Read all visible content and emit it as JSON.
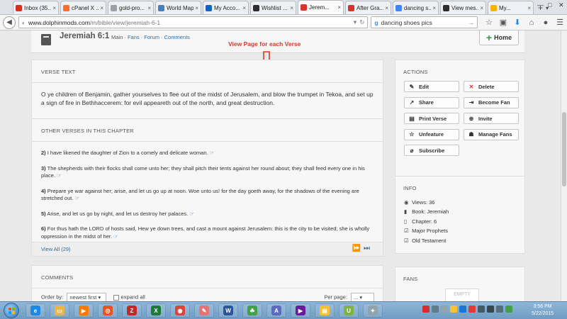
{
  "browser": {
    "tabs": [
      {
        "label": "Inbox (35...",
        "color": "#d93025",
        "active": false
      },
      {
        "label": "cPanel X ...",
        "color": "#ff6c2c",
        "active": false
      },
      {
        "label": "gold-pro...",
        "color": "#9aa0a6",
        "active": false
      },
      {
        "label": "World Map A...",
        "color": "#4a7ebb",
        "active": false
      },
      {
        "label": "My Acco...",
        "color": "#1565c0",
        "active": false
      },
      {
        "label": "Wishlist ...",
        "color": "#2e2e2e",
        "active": false
      },
      {
        "label": "Jerem...",
        "color": "#d9342b",
        "active": true
      },
      {
        "label": "After Gra...",
        "color": "#d9342b",
        "active": false
      },
      {
        "label": "dancing s...",
        "color": "#4285f4",
        "active": false
      },
      {
        "label": "View mes...",
        "color": "#2e2e2e",
        "active": false
      },
      {
        "label": "My...",
        "color": "#f4b400",
        "active": false
      }
    ],
    "url_prefix": "www.dolphinmods.com",
    "url_path": "/m/bible/view/jeremiah-6-1",
    "search_value": "dancing shoes pics"
  },
  "header": {
    "title": "Jeremiah 6:1",
    "links": [
      "Main",
      "Fans",
      "Forum",
      "Comments"
    ],
    "home_label": "Home"
  },
  "annotation": "View Page for each Verse",
  "verse": {
    "heading": "VERSE TEXT",
    "text": "O ye children of Benjamin, gather yourselves to flee out of the midst of Jerusalem, and blow the trumpet in Tekoa, and set up a sign of fire in Bethhaccerem: for evil appeareth out of the north, and great destruction."
  },
  "other_verses": {
    "heading": "OTHER VERSES IN THIS CHAPTER",
    "items": [
      {
        "num": "2)",
        "text": "I have likened the daughter of Zion to a comely and delicate woman."
      },
      {
        "num": "3)",
        "text": "The shepherds with their flocks shall come unto her; they shall pitch their tents against her round about; they shall feed every one in his place."
      },
      {
        "num": "4)",
        "text": "Prepare ye war against her; arise, and let us go up at noon. Woe unto us! for the day goeth away, for the shadows of the evening are stretched out."
      },
      {
        "num": "5)",
        "text": "Arise, and let us go by night, and let us destroy her palaces."
      },
      {
        "num": "6)",
        "text": "For thus hath the LORD of hosts said, Hew ye down trees, and cast a mount against Jerusalem: this is the city to be visited; she is wholly oppression in the midst of her."
      }
    ],
    "view_all": "View All (29)"
  },
  "comments": {
    "heading": "COMMENTS",
    "order_label": "Order by:",
    "order_value": "newest first",
    "expand_label": "expand all",
    "per_page_label": "Per page:",
    "per_page_value": "..."
  },
  "actions": {
    "heading": "ACTIONS",
    "buttons": [
      {
        "label": "Edit",
        "icon": "edit-icon",
        "glyph": "✎",
        "color": "#333333"
      },
      {
        "label": "Delete",
        "icon": "delete-icon",
        "glyph": "✕",
        "color": "#d9342b"
      },
      {
        "label": "Share",
        "icon": "share-icon",
        "glyph": "↗",
        "color": "#333333"
      },
      {
        "label": "Become Fan",
        "icon": "become-fan-icon",
        "glyph": "⇥",
        "color": "#333333"
      },
      {
        "label": "Print Verse",
        "icon": "print-icon",
        "glyph": "▤",
        "color": "#333333"
      },
      {
        "label": "Invite",
        "icon": "invite-icon",
        "glyph": "⊕",
        "color": "#333333"
      },
      {
        "label": "Unfeature",
        "icon": "star-icon",
        "glyph": "☆",
        "color": "#333333"
      },
      {
        "label": "Manage Fans",
        "icon": "users-icon",
        "glyph": "☗",
        "color": "#333333"
      },
      {
        "label": "Subscribe",
        "icon": "paperclip-icon",
        "glyph": "⌀",
        "color": "#333333"
      }
    ]
  },
  "info": {
    "heading": "INFO",
    "items": [
      {
        "icon": "eye-icon",
        "glyph": "◉",
        "text": "Views: 36"
      },
      {
        "icon": "book-icon",
        "glyph": "▮",
        "text": "Book: Jeremiah"
      },
      {
        "icon": "bookmark-icon",
        "glyph": "▯",
        "text": "Chapter: 6"
      },
      {
        "icon": "check-icon",
        "glyph": "☑",
        "text": "Major Prophets"
      },
      {
        "icon": "check-icon",
        "glyph": "☑",
        "text": "Old Testament"
      }
    ]
  },
  "fans": {
    "heading": "FANS",
    "empty_label": "EMPTY"
  },
  "taskbar": {
    "apps": [
      {
        "name": "internet-explorer",
        "glyph": "e",
        "color": "#1e88e5"
      },
      {
        "name": "file-explorer",
        "glyph": "▭",
        "color": "#e6b84a"
      },
      {
        "name": "media-player",
        "glyph": "▶",
        "color": "#f57c00"
      },
      {
        "name": "firefox",
        "glyph": "◎",
        "color": "#e8541e"
      },
      {
        "name": "filezilla",
        "glyph": "Z",
        "color": "#c62828"
      },
      {
        "name": "excel",
        "glyph": "X",
        "color": "#1d7a3a"
      },
      {
        "name": "chrome",
        "glyph": "◉",
        "color": "#db4437"
      },
      {
        "name": "paint",
        "glyph": "✎",
        "color": "#e57373"
      },
      {
        "name": "word",
        "glyph": "W",
        "color": "#2b579a"
      },
      {
        "name": "frog-app",
        "glyph": "☘",
        "color": "#43a047"
      },
      {
        "name": "ab-app",
        "glyph": "A",
        "color": "#5c6bc0"
      },
      {
        "name": "purple-app",
        "glyph": "▶",
        "color": "#6a1b9a"
      },
      {
        "name": "notes-app",
        "glyph": "▤",
        "color": "#fbc02d"
      },
      {
        "name": "ultraedit",
        "glyph": "U",
        "color": "#7cb342"
      },
      {
        "name": "tools-app",
        "glyph": "✦",
        "color": "#90a4ae"
      }
    ],
    "time": "3:56 PM",
    "date": "5/22/2015"
  }
}
